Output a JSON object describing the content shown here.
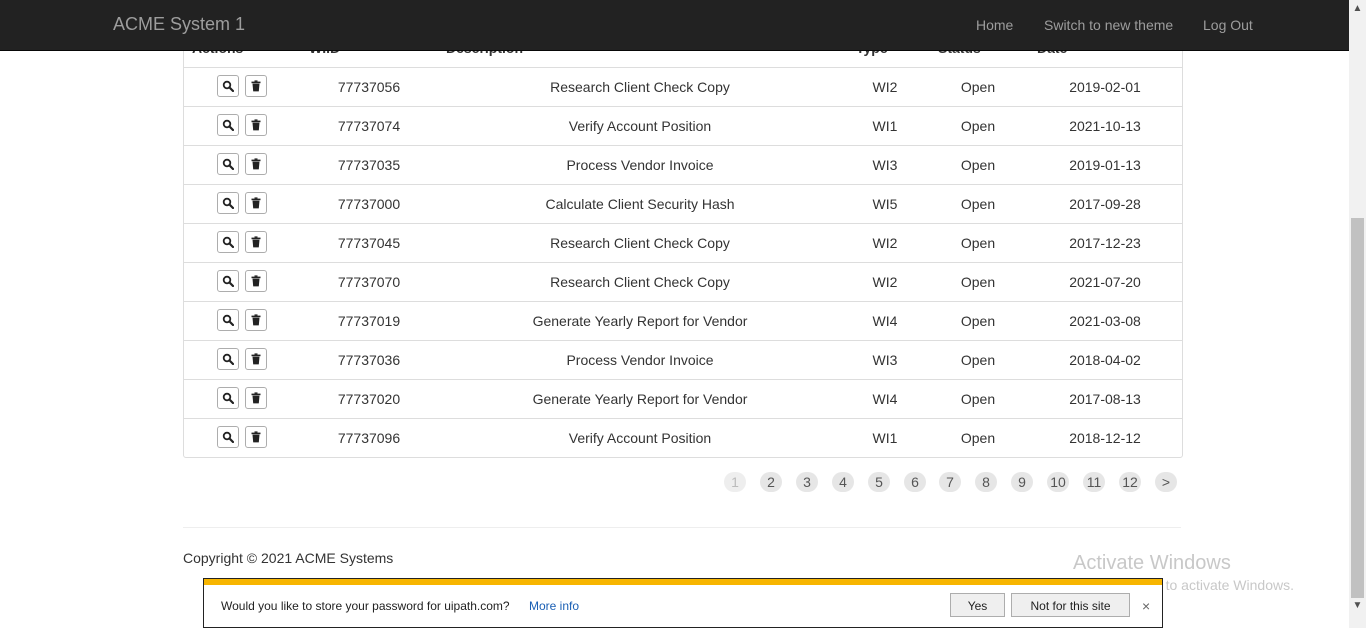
{
  "navbar": {
    "brand": "ACME System 1",
    "links": [
      "Home",
      "Switch to new theme",
      "Log Out"
    ]
  },
  "table": {
    "headers": [
      "Actions",
      "WIID",
      "Description",
      "Type",
      "Status",
      "Date"
    ],
    "rows": [
      {
        "wiid": "77737056",
        "description": "Research Client Check Copy",
        "type": "WI2",
        "status": "Open",
        "date": "2019-02-01"
      },
      {
        "wiid": "77737074",
        "description": "Verify Account Position",
        "type": "WI1",
        "status": "Open",
        "date": "2021-10-13"
      },
      {
        "wiid": "77737035",
        "description": "Process Vendor Invoice",
        "type": "WI3",
        "status": "Open",
        "date": "2019-01-13"
      },
      {
        "wiid": "77737000",
        "description": "Calculate Client Security Hash",
        "type": "WI5",
        "status": "Open",
        "date": "2017-09-28"
      },
      {
        "wiid": "77737045",
        "description": "Research Client Check Copy",
        "type": "WI2",
        "status": "Open",
        "date": "2017-12-23"
      },
      {
        "wiid": "77737070",
        "description": "Research Client Check Copy",
        "type": "WI2",
        "status": "Open",
        "date": "2021-07-20"
      },
      {
        "wiid": "77737019",
        "description": "Generate Yearly Report for Vendor",
        "type": "WI4",
        "status": "Open",
        "date": "2021-03-08"
      },
      {
        "wiid": "77737036",
        "description": "Process Vendor Invoice",
        "type": "WI3",
        "status": "Open",
        "date": "2018-04-02"
      },
      {
        "wiid": "77737020",
        "description": "Generate Yearly Report for Vendor",
        "type": "WI4",
        "status": "Open",
        "date": "2017-08-13"
      },
      {
        "wiid": "77737096",
        "description": "Verify Account Position",
        "type": "WI1",
        "status": "Open",
        "date": "2018-12-12"
      }
    ],
    "row_icons": [
      "search-icon",
      "trash-icon"
    ]
  },
  "pagination": {
    "pages": [
      "1",
      "2",
      "3",
      "4",
      "5",
      "6",
      "7",
      "8",
      "9",
      "10",
      "11",
      "12",
      ">"
    ],
    "current": "1"
  },
  "footer": {
    "copyright": "Copyright © 2021 ACME Systems"
  },
  "watermark": {
    "title": "Activate Windows",
    "subtitle": "Go to Settings to activate Windows."
  },
  "password_bar": {
    "message": "Would you like to store your password for uipath.com?",
    "more_info": "More info",
    "yes": "Yes",
    "no": "Not for this site",
    "close": "×"
  },
  "colors": {
    "navbar_bg": "#222222",
    "accent": "#f7b500",
    "link": "#1a5fb4"
  }
}
